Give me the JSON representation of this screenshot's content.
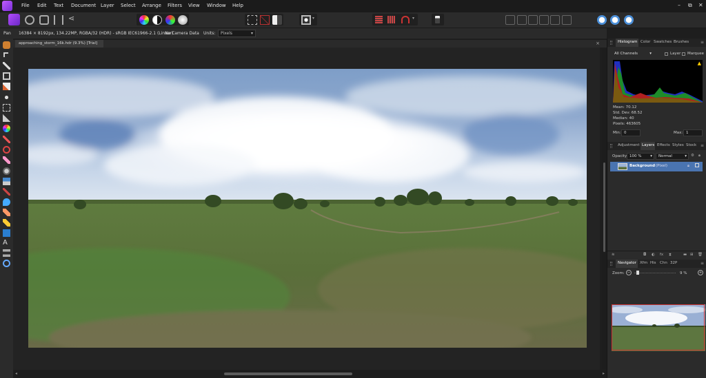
{
  "menubar": {
    "items": [
      "File",
      "Edit",
      "Text",
      "Document",
      "Layer",
      "Select",
      "Arrange",
      "Filters",
      "View",
      "Window",
      "Help"
    ]
  },
  "context": {
    "tool": "Pan",
    "doc_info": "16384 × 8192px, 134.22MP, RGBA/32 (HDR) - sRGB IEC61966-2.1 (Linear)",
    "camera": "No Camera Data",
    "units_label": "Units:",
    "units_value": "Pixels"
  },
  "document": {
    "tab_title": "approaching_storm_16k.hdr (9.3%) [Trial]"
  },
  "histogram_panel": {
    "tabs": [
      "Histogram",
      "Color",
      "Swatches",
      "Brushes"
    ],
    "channel": "All Channels",
    "layer_label": "Layer",
    "marquee_label": "Marquee",
    "stats": [
      "Mean: 70.12",
      "Std. Dev: 68.52",
      "Median: 40",
      "Pixels: 463605"
    ],
    "min_label": "Min:",
    "min_value": "0",
    "max_label": "Max:",
    "max_value": "1"
  },
  "layers_panel": {
    "tabs": [
      "Adjustment",
      "Layers",
      "Effects",
      "Styles",
      "Stock"
    ],
    "opacity_label": "Opacity:",
    "opacity_value": "100 %",
    "blend_mode": "Normal",
    "layer_name": "Background",
    "layer_type": "(Pixel)"
  },
  "navigator_panel": {
    "tabs": [
      "Navigator",
      "Xfm",
      "His",
      "Chn",
      "32P"
    ],
    "zoom_label": "Zoom:",
    "zoom_value": "9 %"
  },
  "colors": {
    "accent": "#4a7fc1",
    "selected_layer": "#4a74b0"
  }
}
